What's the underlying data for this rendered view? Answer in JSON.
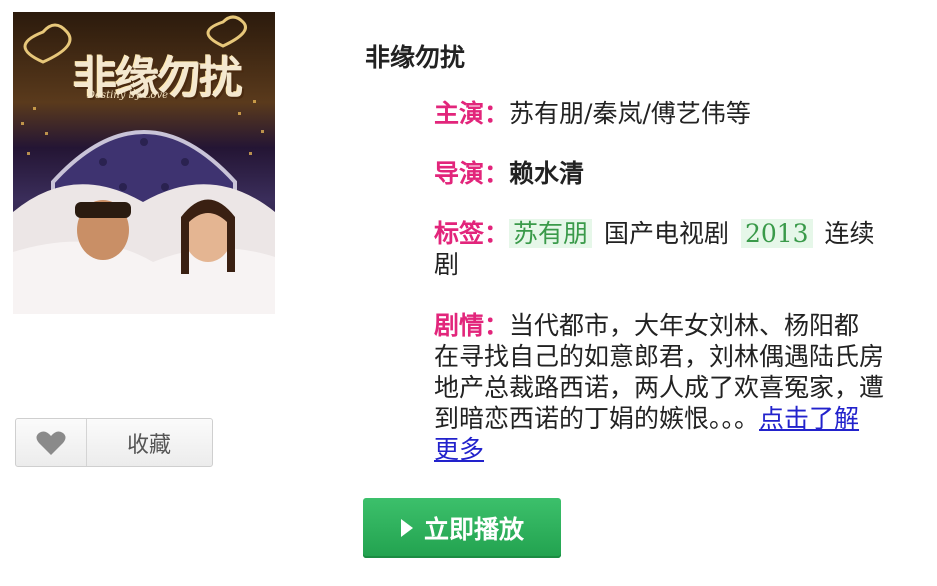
{
  "poster": {
    "title_art": "非缘勿扰",
    "subtitle_art": "Destiny by Love"
  },
  "favorite": {
    "label": "收藏",
    "icon": "heart-icon"
  },
  "show": {
    "title": "非缘勿扰",
    "cast_label": "主演：",
    "cast_value": "苏有朋/秦岚/傅艺伟等",
    "director_label": "导演：",
    "director_value": "赖水清",
    "tags_label": "标签：",
    "tags": [
      "苏有朋",
      "国产电视剧",
      "2013",
      "连续剧"
    ],
    "plot_label": "剧情：",
    "plot_text": "当代都市，大年女刘林、杨阳都在寻找自己的如意郎君，刘林偶遇陆氏房地产总裁路西诺，两人成了欢喜冤家，遭到暗恋西诺的丁娟的嫉恨。。。",
    "more_link": "点击了解更多"
  },
  "play_button": {
    "label": "立即播放",
    "icon": "play-icon"
  },
  "colors": {
    "label_pink": "#e2257b",
    "tag_green_bg": "#e6f7e9",
    "tag_green_text": "#3a9a4a",
    "play_green": "#2fb35d",
    "link_blue": "#2222cc"
  }
}
